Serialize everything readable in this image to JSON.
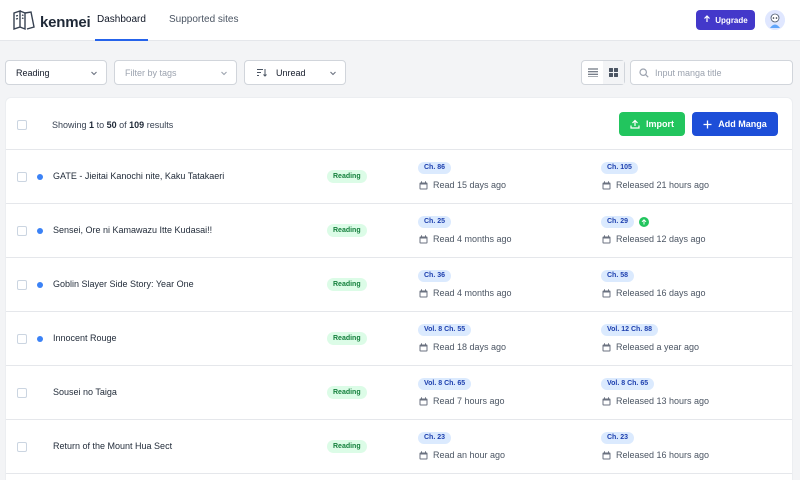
{
  "app": {
    "name": "kenmei"
  },
  "nav": {
    "tabs": [
      "Dashboard",
      "Supported sites"
    ],
    "upgrade_label": "Upgrade"
  },
  "filters": {
    "status_value": "Reading",
    "tags_placeholder": "Filter by tags",
    "sort_value": "Unread",
    "search_placeholder": "Input manga title"
  },
  "list": {
    "results_prefix": "Showing",
    "results_from": "1",
    "results_to_word": "to",
    "results_to": "50",
    "results_of_word": "of",
    "results_total": "109",
    "results_suffix": "results",
    "import_label": "Import",
    "add_label": "Add Manga"
  },
  "rows": [
    {
      "title": "GATE - Jieitai Kanochi nite, Kaku Tatakaeri",
      "status": "Reading",
      "read_chip": "Ch. 86",
      "read_text": "Read 15 days ago",
      "latest_chip": "Ch. 105",
      "latest_text": "Released 21 hours ago",
      "unread": true,
      "new_badge": false
    },
    {
      "title": "Sensei, Ore ni Kamawazu Itte Kudasai!!",
      "status": "Reading",
      "read_chip": "Ch. 25",
      "read_text": "Read 4 months ago",
      "latest_chip": "Ch. 29",
      "latest_text": "Released 12 days ago",
      "unread": true,
      "new_badge": true
    },
    {
      "title": "Goblin Slayer Side Story: Year One",
      "status": "Reading",
      "read_chip": "Ch. 36",
      "read_text": "Read 4 months ago",
      "latest_chip": "Ch. 58",
      "latest_text": "Released 16 days ago",
      "unread": true,
      "new_badge": false
    },
    {
      "title": "Innocent Rouge",
      "status": "Reading",
      "read_chip": "Vol. 8 Ch. 55",
      "read_text": "Read 18 days ago",
      "latest_chip": "Vol. 12 Ch. 88",
      "latest_text": "Released a year ago",
      "unread": true,
      "new_badge": false
    },
    {
      "title": "Sousei no Taiga",
      "status": "Reading",
      "read_chip": "Vol. 8 Ch. 65",
      "read_text": "Read 7 hours ago",
      "latest_chip": "Vol. 8 Ch. 65",
      "latest_text": "Released 13 hours ago",
      "unread": false,
      "new_badge": false
    },
    {
      "title": "Return of the Mount Hua Sect",
      "status": "Reading",
      "read_chip": "Ch. 23",
      "read_text": "Read an hour ago",
      "latest_chip": "Ch. 23",
      "latest_text": "Released 16 hours ago",
      "unread": false,
      "new_badge": false
    }
  ],
  "colors": {
    "accent": "#2563eb",
    "upgrade": "#4338ca",
    "import": "#22c55e",
    "add": "#1d4ed8",
    "status_bg": "#dcfce7",
    "chip_bg": "#dbeafe"
  },
  "icons": {
    "logo": "kenmei-logo-icon",
    "upgrade": "arrow-up-icon",
    "chevron": "chevron-down-icon",
    "sort": "sort-descending-icon",
    "list_view": "list-view-icon",
    "grid_view": "grid-view-icon",
    "search": "search-icon",
    "import": "upload-icon",
    "add": "plus-icon",
    "calendar": "calendar-icon",
    "new": "arrow-up-circle-icon"
  }
}
